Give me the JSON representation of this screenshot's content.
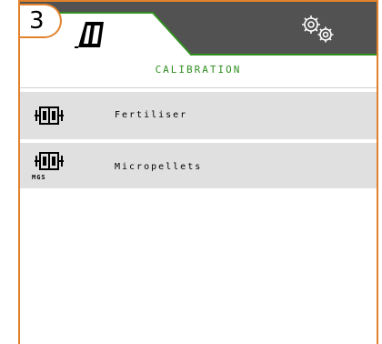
{
  "header": {
    "step_number": "3",
    "menu_icon": "seed-drill-icon",
    "settings_icon": "gears-icon"
  },
  "section": {
    "title": "CALIBRATION"
  },
  "items": [
    {
      "label": "Fertiliser",
      "icon": "hopper-icon",
      "sublabel": ""
    },
    {
      "label": "Micropellets",
      "icon": "hopper-icon",
      "sublabel": "MGS"
    }
  ],
  "colors": {
    "accent_orange": "#e3822d",
    "accent_green": "#2f8f1f",
    "header_dark": "#525252",
    "row_bg": "#e0e0e0"
  }
}
